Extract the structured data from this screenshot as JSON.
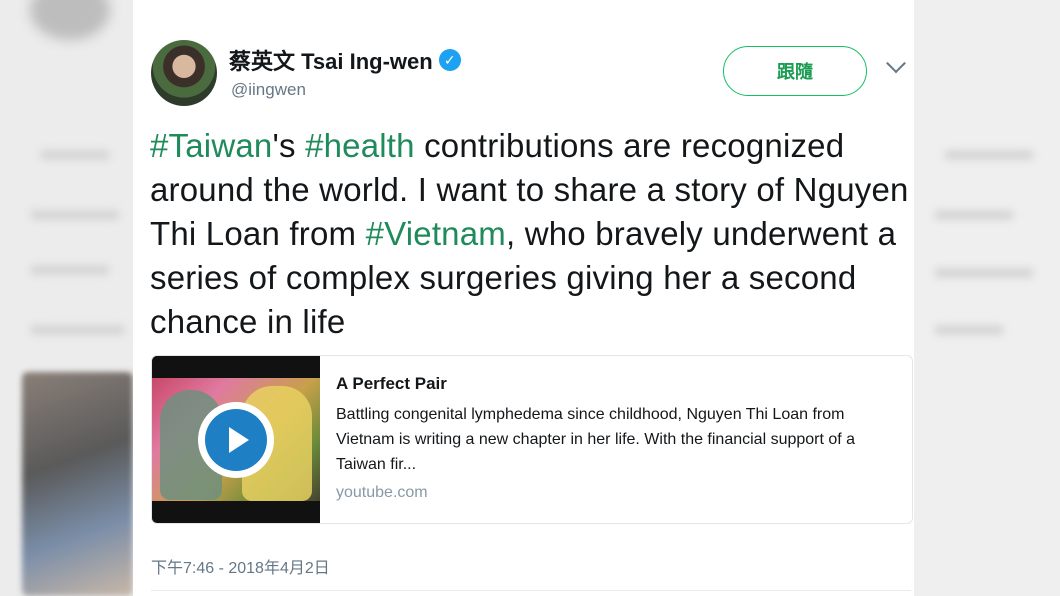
{
  "tweet": {
    "display_name": "蔡英文 Tsai Ing-wen",
    "handle": "@iingwen",
    "follow_label": "跟隨",
    "text_segments": [
      {
        "text": "#Taiwan",
        "hashtag": true
      },
      {
        "text": "'s ",
        "hashtag": false
      },
      {
        "text": "#health",
        "hashtag": true
      },
      {
        "text": " contributions are recognized around the world. I want to share a story of Nguyen Thi Loan from ",
        "hashtag": false
      },
      {
        "text": "#Vietnam",
        "hashtag": true
      },
      {
        "text": ", who bravely underwent a series of complex surgeries giving her a second chance in life",
        "hashtag": false
      }
    ],
    "timestamp": "下午7:46 - 2018年4月2日"
  },
  "link_card": {
    "title": "A Perfect Pair",
    "description": "Battling congenital lymphedema since childhood, Nguyen Thi Loan from Vietnam is writing a new chapter in her life. With the financial support of a Taiwan fir...",
    "domain": "youtube.com"
  },
  "colors": {
    "hashtag": "#1f8a5a",
    "verified": "#1da1f2",
    "follow": "#17bf63"
  }
}
